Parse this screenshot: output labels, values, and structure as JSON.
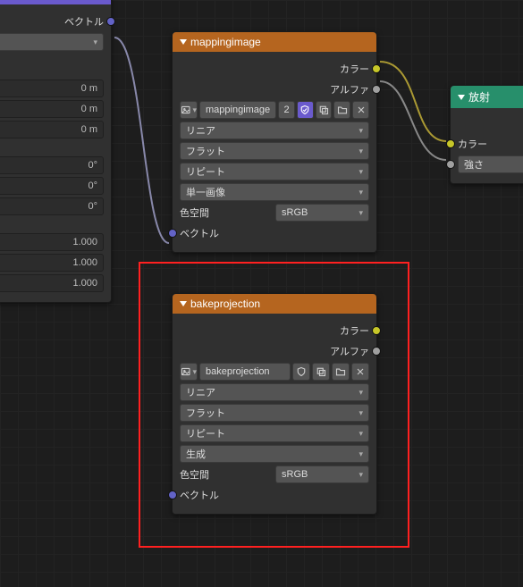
{
  "leftNode": {
    "header": "",
    "out_vector": "ベクトル",
    "field0m_1": "0 m",
    "field0m_2": "0 m",
    "field0m_3": "0 m",
    "field0d_1": "0°",
    "field0d_2": "0°",
    "field0d_3": "0°",
    "field1_1": "1.000",
    "field1_2": "1.000",
    "field1_3": "1.000"
  },
  "mappingNode": {
    "title": "mappingimage",
    "out_color": "カラー",
    "out_alpha": "アルファ",
    "name": "mappingimage",
    "count": "2",
    "interp": "リニア",
    "projection": "フラット",
    "extension": "リピート",
    "source": "単一画像",
    "colorspace_label": "色空間",
    "colorspace_value": "sRGB",
    "vector": "ベクトル"
  },
  "bakeNode": {
    "title": "bakeprojection",
    "out_color": "カラー",
    "out_alpha": "アルファ",
    "name": "bakeprojection",
    "interp": "リニア",
    "projection": "フラット",
    "extension": "リピート",
    "source": "生成",
    "colorspace_label": "色空間",
    "colorspace_value": "sRGB",
    "vector": "ベクトル"
  },
  "emitNode": {
    "title": "放射",
    "color": "カラー",
    "strength": "強さ"
  }
}
